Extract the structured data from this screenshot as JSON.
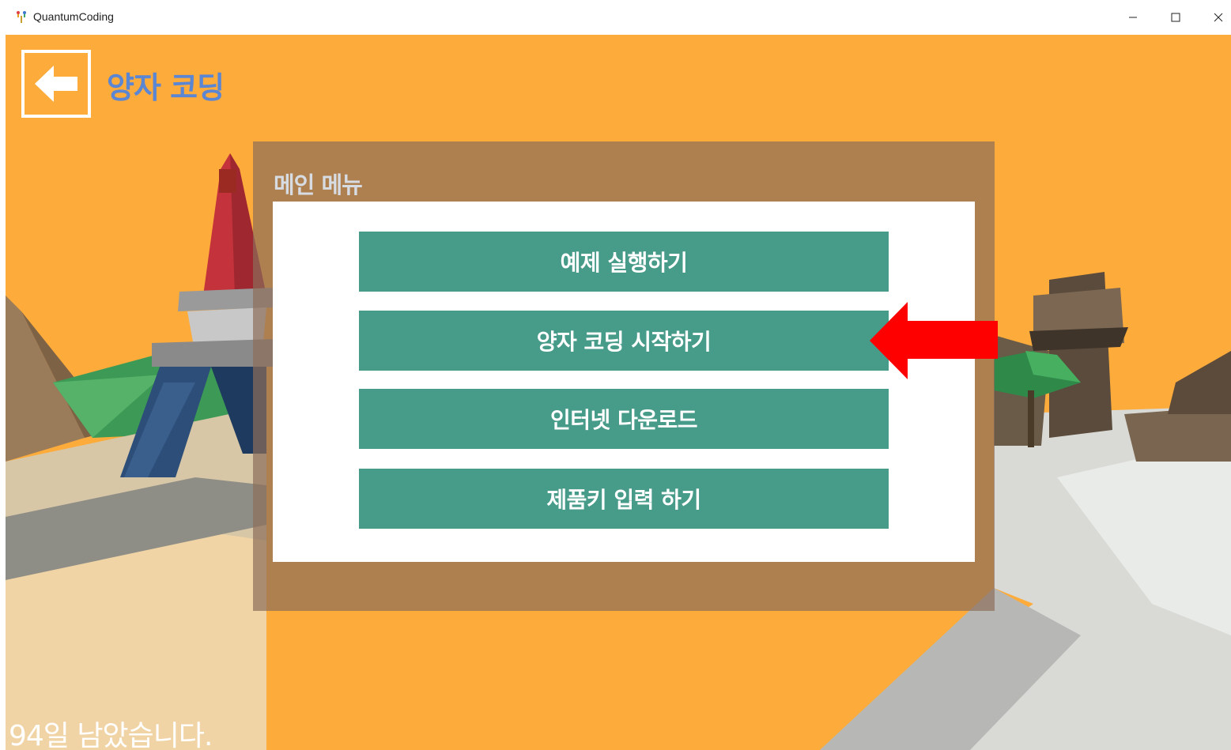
{
  "window": {
    "title": "QuantumCoding",
    "minimize_glyph": "–",
    "maximize_glyph": "☐",
    "close_glyph": "✕"
  },
  "header": {
    "back_icon": "arrow-left-icon",
    "title": "양자 코딩"
  },
  "menu": {
    "title": "메인 메뉴",
    "buttons": [
      {
        "label": "예제 실행하기"
      },
      {
        "label": "양자 코딩 시작하기"
      },
      {
        "label": "인터넷 다운로드"
      },
      {
        "label": "제품키 입력 하기"
      }
    ]
  },
  "footer": {
    "days_left": "94일 남았습니다."
  },
  "colors": {
    "sky": "#fdab3a",
    "button": "#479b89",
    "title": "#5b86d4",
    "annotation_arrow": "#ff0000"
  }
}
